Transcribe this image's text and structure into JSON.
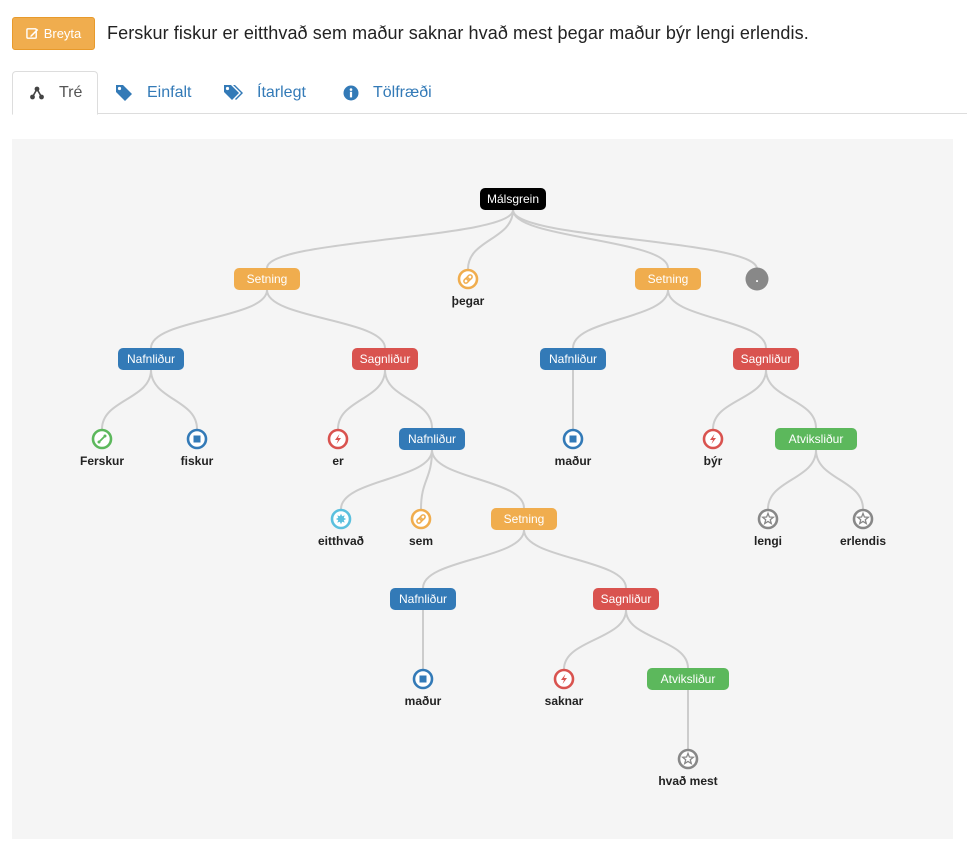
{
  "toolbar": {
    "edit_label": "Breyta"
  },
  "sentence": "Ferskur fiskur er eitthvað sem maður saknar hvað mest þegar maður býr lengi erlendis.",
  "tabs": [
    {
      "label": "Tré",
      "icon": "tree-icon",
      "active": true
    },
    {
      "label": "Einfalt",
      "icon": "tag-icon",
      "active": false
    },
    {
      "label": "Ítarlegt",
      "icon": "tags-icon",
      "active": false
    },
    {
      "label": "Tölfræði",
      "icon": "info-circle-icon",
      "active": false
    }
  ],
  "colors": {
    "black": "#000000",
    "orange": "#f0ad4e",
    "blue": "#337ab7",
    "red": "#d9534f",
    "green": "#5cb85c",
    "cyan": "#5bc0de",
    "gray": "#888888",
    "edge": "#cccccc",
    "panel": "#f5f5f5"
  },
  "tree": {
    "nodes": [
      {
        "id": "n1",
        "type": "box",
        "label": "Málsgrein",
        "color": "black"
      },
      {
        "id": "n2",
        "type": "box",
        "label": "Setning",
        "color": "orange"
      },
      {
        "id": "n3",
        "type": "leaf",
        "label": "þegar",
        "color": "orange",
        "icon": "link"
      },
      {
        "id": "n4",
        "type": "box",
        "label": "Setning",
        "color": "orange"
      },
      {
        "id": "n5",
        "type": "dot",
        "label": ".",
        "color": "gray"
      },
      {
        "id": "n6",
        "type": "box",
        "label": "Nafnliður",
        "color": "blue"
      },
      {
        "id": "n7",
        "type": "box",
        "label": "Sagnliður",
        "color": "red"
      },
      {
        "id": "n8",
        "type": "box",
        "label": "Nafnliður",
        "color": "blue"
      },
      {
        "id": "n9",
        "type": "box",
        "label": "Sagnliður",
        "color": "red"
      },
      {
        "id": "n10",
        "type": "leaf",
        "label": "Ferskur",
        "color": "green",
        "icon": "adjective"
      },
      {
        "id": "n11",
        "type": "leaf",
        "label": "fiskur",
        "color": "blue",
        "icon": "noun"
      },
      {
        "id": "n12",
        "type": "leaf",
        "label": "er",
        "color": "red",
        "icon": "verb"
      },
      {
        "id": "n13",
        "type": "box",
        "label": "Nafnliður",
        "color": "blue"
      },
      {
        "id": "n14",
        "type": "leaf",
        "label": "maður",
        "color": "blue",
        "icon": "noun"
      },
      {
        "id": "n15",
        "type": "leaf",
        "label": "býr",
        "color": "red",
        "icon": "verb"
      },
      {
        "id": "n16",
        "type": "box",
        "label": "Atviksliður",
        "color": "green"
      },
      {
        "id": "n17",
        "type": "leaf",
        "label": "eitthvað",
        "color": "cyan",
        "icon": "pronoun"
      },
      {
        "id": "n18",
        "type": "leaf",
        "label": "sem",
        "color": "orange",
        "icon": "link"
      },
      {
        "id": "n19",
        "type": "box",
        "label": "Setning",
        "color": "orange"
      },
      {
        "id": "n20",
        "type": "leaf",
        "label": "lengi",
        "color": "gray",
        "icon": "adverb"
      },
      {
        "id": "n21",
        "type": "leaf",
        "label": "erlendis",
        "color": "gray",
        "icon": "adverb"
      },
      {
        "id": "n22",
        "type": "box",
        "label": "Nafnliður",
        "color": "blue"
      },
      {
        "id": "n23",
        "type": "box",
        "label": "Sagnliður",
        "color": "red"
      },
      {
        "id": "n24",
        "type": "leaf",
        "label": "maður",
        "color": "blue",
        "icon": "noun"
      },
      {
        "id": "n25",
        "type": "leaf",
        "label": "saknar",
        "color": "red",
        "icon": "verb"
      },
      {
        "id": "n26",
        "type": "box",
        "label": "Atviksliður",
        "color": "green"
      },
      {
        "id": "n27",
        "type": "leaf",
        "label": "hvað mest",
        "color": "gray",
        "icon": "adverb"
      }
    ],
    "edges": [
      [
        "n1",
        "n2"
      ],
      [
        "n1",
        "n3"
      ],
      [
        "n1",
        "n4"
      ],
      [
        "n1",
        "n5"
      ],
      [
        "n2",
        "n6"
      ],
      [
        "n2",
        "n7"
      ],
      [
        "n4",
        "n8"
      ],
      [
        "n4",
        "n9"
      ],
      [
        "n6",
        "n10"
      ],
      [
        "n6",
        "n11"
      ],
      [
        "n7",
        "n12"
      ],
      [
        "n7",
        "n13"
      ],
      [
        "n8",
        "n14"
      ],
      [
        "n9",
        "n15"
      ],
      [
        "n9",
        "n16"
      ],
      [
        "n13",
        "n17"
      ],
      [
        "n13",
        "n18"
      ],
      [
        "n13",
        "n19"
      ],
      [
        "n16",
        "n20"
      ],
      [
        "n16",
        "n21"
      ],
      [
        "n19",
        "n22"
      ],
      [
        "n19",
        "n23"
      ],
      [
        "n22",
        "n24"
      ],
      [
        "n23",
        "n25"
      ],
      [
        "n23",
        "n26"
      ],
      [
        "n26",
        "n27"
      ]
    ]
  }
}
